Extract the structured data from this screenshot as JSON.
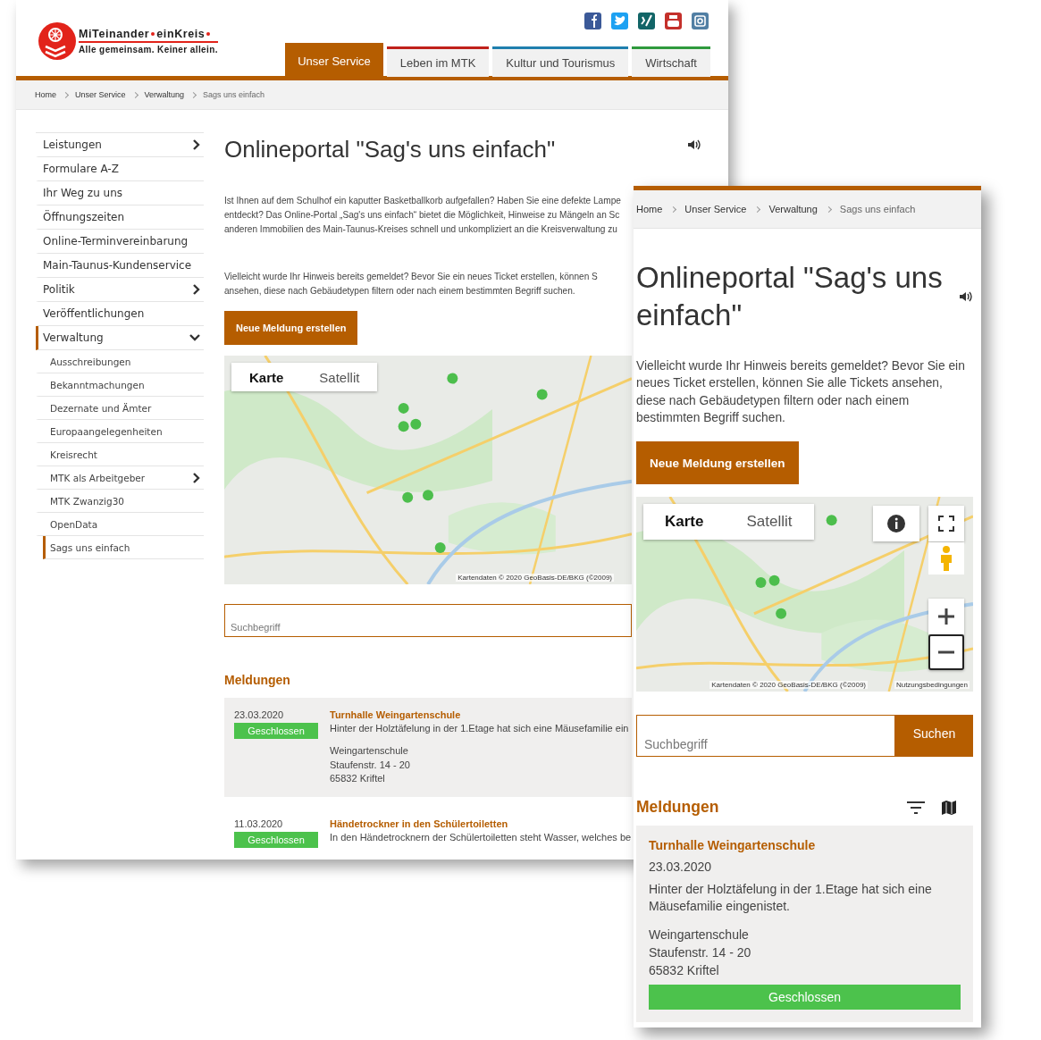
{
  "desktop": {
    "logo": {
      "title_parts": [
        "MiTeinander",
        "einKreis"
      ],
      "tagline": "Alle gemeinsam. Keiner allein."
    },
    "nav_tabs": [
      {
        "label": "Unser Service",
        "selected": true,
        "color": "#b55d00"
      },
      {
        "label": "Leben im MTK",
        "selected": false,
        "color": "#c0211b"
      },
      {
        "label": "Kultur und Tourismus",
        "selected": false,
        "color": "#1f7fae"
      },
      {
        "label": "Wirtschaft",
        "selected": false,
        "color": "#2f9a3d"
      }
    ],
    "breadcrumb": [
      "Home",
      "Unser Service",
      "Verwaltung",
      "Sags uns einfach"
    ],
    "sidebar": {
      "items": [
        {
          "label": "Leistungen",
          "selected": false,
          "has_children": true,
          "expanded": false
        },
        {
          "label": "Formulare A-Z",
          "selected": false,
          "has_children": false
        },
        {
          "label": "Ihr Weg zu uns",
          "selected": false,
          "has_children": false
        },
        {
          "label": "Öffnungszeiten",
          "selected": false,
          "has_children": false
        },
        {
          "label": "Online-Terminvereinbarung",
          "selected": false,
          "has_children": false
        },
        {
          "label": "Main-Taunus-Kundenservice",
          "selected": false,
          "has_children": false
        },
        {
          "label": "Politik",
          "selected": false,
          "has_children": true,
          "expanded": false
        },
        {
          "label": "Veröffentlichungen",
          "selected": false,
          "has_children": false
        },
        {
          "label": "Verwaltung",
          "selected": true,
          "has_children": true,
          "expanded": true,
          "children": [
            {
              "label": "Ausschreibungen",
              "selected": false,
              "has_children": false
            },
            {
              "label": "Bekanntmachungen",
              "selected": false,
              "has_children": false
            },
            {
              "label": "Dezernate und Ämter",
              "selected": false,
              "has_children": false
            },
            {
              "label": "Europaangelegenheiten",
              "selected": false,
              "has_children": false
            },
            {
              "label": "Kreisrecht",
              "selected": false,
              "has_children": false
            },
            {
              "label": "MTK als Arbeitgeber",
              "selected": false,
              "has_children": true
            },
            {
              "label": "MTK Zwanzig30",
              "selected": false,
              "has_children": false
            },
            {
              "label": "OpenData",
              "selected": false,
              "has_children": false
            },
            {
              "label": "Sags uns einfach",
              "selected": true,
              "has_children": false
            }
          ]
        }
      ]
    },
    "title": "Onlineportal \"Sag's uns einfach\"",
    "intro_lines": [
      "Ist Ihnen auf dem Schulhof ein kaputter Basketballkorb aufgefallen? Haben Sie eine defekte Lampe",
      "entdeckt? Das Online-Portal „Sag's uns einfach“ bietet die Möglichkeit, Hinweise zu Mängeln an Sc",
      "anderen Immobilien des Main-Taunus-Kreises schnell und unkompliziert an die Kreisverwaltung zu"
    ],
    "hint_lines": [
      "Vielleicht wurde Ihr Hinweis bereits gemeldet? Bevor Sie ein neues Ticket erstellen, können S",
      "ansehen, diese nach Gebäudetypen filtern oder nach einem bestimmten Begriff suchen."
    ],
    "new_report_button": "Neue Meldung erstellen",
    "map": {
      "tabs": [
        {
          "label": "Karte",
          "selected": true
        },
        {
          "label": "Satellit",
          "selected": false
        }
      ],
      "attribution": "Kartendaten © 2020 GeoBasis-DE/BKG (©2009)"
    },
    "search": {
      "placeholder": "Suchbegriff"
    },
    "reports_heading": "Meldungen",
    "reports": [
      {
        "date": "23.03.2020",
        "status": "Geschlossen",
        "title": "Turnhalle Weingartenschule",
        "description": "Hinter der Holztäfelung in der 1.Etage hat sich eine Mäusefamilie ein",
        "address_lines": [
          "Weingartenschule",
          "Staufenstr. 14 - 20",
          "65832 Kriftel"
        ]
      },
      {
        "date": "11.03.2020",
        "status": "Geschlossen",
        "title": "Händetrockner in den Schülertoiletten",
        "description": "In den Händetrocknern der Schülertoiletten steht Wasser, welches be"
      }
    ]
  },
  "mobile": {
    "breadcrumb": [
      "Home",
      "Unser Service",
      "Verwaltung",
      "Sags uns einfach"
    ],
    "title": "Onlineportal \"Sag's uns einfach\"",
    "text": "Vielleicht wurde Ihr Hinweis bereits gemeldet? Bevor Sie ein neues Ticket erstellen, können Sie alle Tickets ansehen, diese nach Gebäudetypen filtern oder nach einem bestimmten Begriff suchen.",
    "new_report_button": "Neue Meldung erstellen",
    "map": {
      "tabs": [
        {
          "label": "Karte",
          "selected": true
        },
        {
          "label": "Satellit",
          "selected": false
        }
      ],
      "attribution": "Kartendaten © 2020 GeoBasis-DE/BKG (©2009)",
      "terms": "Nutzungsbedingungen"
    },
    "search": {
      "placeholder": "Suchbegriff",
      "button": "Suchen"
    },
    "reports_heading": "Meldungen",
    "reports": [
      {
        "title": "Turnhalle Weingartenschule",
        "date": "23.03.2020",
        "description": "Hinter der Holztäfelung in der 1.Etage hat sich eine Mäusefamilie eingenistet.",
        "address_lines": [
          "Weingartenschule",
          "Staufenstr. 14 - 20",
          "65832 Kriftel"
        ],
        "status": "Geschlossen"
      }
    ]
  }
}
